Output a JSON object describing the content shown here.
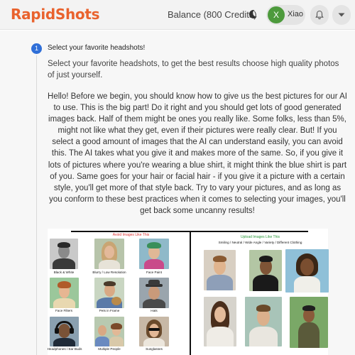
{
  "app": {
    "logo_part1": "Rapid",
    "logo_part2": "Shots",
    "balance": "Balance (800 Credits)",
    "user_initial": "X",
    "user_name": "Xiao"
  },
  "step": {
    "number": "1",
    "title": "Select your favorite headshots!",
    "description": "Select your favorite headshots, to get the best results choose high quality photos of just yourself."
  },
  "intro": "Hello! Before we begin, you should know how to give us the best pictures for our AI to use. This is the big part! Do it right and you should get lots of good generated images back. Half of them might be ones you really like. Some folks, less than 5%, might not like what they get, even if their pictures were really clear. But! If you select a good amount of images that the AI can understand easily, you can avoid this. The AI takes what you give it and makes more of the same. So, if you give it lots of pictures where you're wearing a blue shirt, it might think the blue shirt is part of you. Same goes for your hair or facial hair - if you give it a picture with a certain style, you'll get more of that style back. Try to vary your pictures, and as long as you conform to these best practices when it comes to selecting your images, you'll get back some uncanny results!",
  "guide": {
    "avoid_title": "Avoid Images Like This",
    "avoid_items": [
      "Black & White",
      "Blurry / Low Resolution",
      "Face Paint",
      "Face Filters",
      "Pets in Frame",
      "Hats",
      "Headphones / Ear Buds",
      "Multiple People",
      "Sunglasses"
    ],
    "upload_title": "Upload Images Like This",
    "upload_subtitle": "Smiling / Neutral / Wide Angle / Variety / Different Clothing"
  },
  "colors": {
    "brand": "#e9622d",
    "step_badge": "#2f6fd8",
    "avatar": "#4d9a3c",
    "avoid": "#d33333",
    "upload": "#2a9a3a"
  },
  "icons": {
    "theme": "moon-icon",
    "notifications": "bell-icon",
    "menu": "chevron-down-icon"
  }
}
